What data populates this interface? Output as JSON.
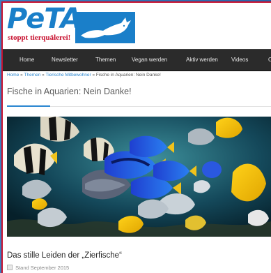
{
  "brand": {
    "logo_word": "PeTA",
    "logo_tagline": "stoppt tierquälerei!",
    "logo_color": "#1a7fc9",
    "tagline_color": "#c8102e"
  },
  "nav": {
    "items": [
      "Home",
      "Newsletter",
      "Themen",
      "Vegan werden",
      "Aktiv werden",
      "Videos",
      "O"
    ]
  },
  "breadcrumb": {
    "items": [
      "Home",
      "Themen",
      "Tierische Mitbewohner",
      "Fische in Aquarien: Nein Danke!"
    ],
    "separator": "»"
  },
  "page": {
    "title": "Fische in Aquarien: Nein Danke!",
    "accent_color": "#2a86d0"
  },
  "article": {
    "title": "Das stille Leiden der „Zierfische“",
    "date": "Stand September 2015",
    "date_icon": "calendar-icon"
  }
}
